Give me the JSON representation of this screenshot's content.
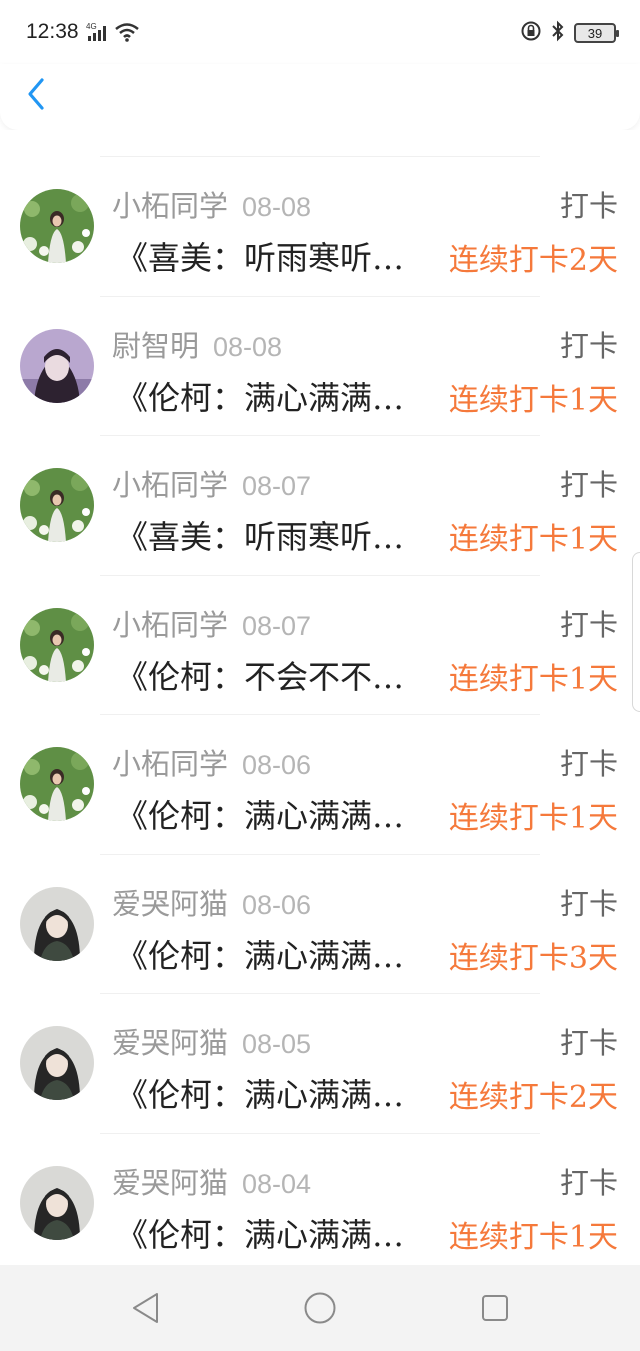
{
  "status_bar": {
    "time": "12:38",
    "network": "4G",
    "battery": "39"
  },
  "header": {
    "back_icon": "chevron-left-icon",
    "accent_color": "#2196f3"
  },
  "items": [
    {
      "name": "小柘同学",
      "date": "08-08",
      "label": "打卡",
      "title": "《喜美：听雨寒听雨寒",
      "streak": "连续打卡2天",
      "avatar": "flower-field"
    },
    {
      "name": "尉智明",
      "date": "08-08",
      "label": "打卡",
      "title": "《伦柯：满心满满心满",
      "streak": "连续打卡1天",
      "avatar": "purple-portrait"
    },
    {
      "name": "小柘同学",
      "date": "08-07",
      "label": "打卡",
      "title": "《喜美：听雨寒听雨寒",
      "streak": "连续打卡1天",
      "avatar": "flower-field"
    },
    {
      "name": "小柘同学",
      "date": "08-07",
      "label": "打卡",
      "title": "《伦柯：不会不不会不",
      "streak": "连续打卡1天",
      "avatar": "flower-field"
    },
    {
      "name": "小柘同学",
      "date": "08-06",
      "label": "打卡",
      "title": "《伦柯：满心满满心满",
      "streak": "连续打卡1天",
      "avatar": "flower-field"
    },
    {
      "name": "爱哭阿猫",
      "date": "08-06",
      "label": "打卡",
      "title": "《伦柯：满心满满心满",
      "streak": "连续打卡3天",
      "avatar": "grey-portrait"
    },
    {
      "name": "爱哭阿猫",
      "date": "08-05",
      "label": "打卡",
      "title": "《伦柯：满心满满心满",
      "streak": "连续打卡2天",
      "avatar": "grey-portrait"
    },
    {
      "name": "爱哭阿猫",
      "date": "08-04",
      "label": "打卡",
      "title": "《伦柯：满心满满心满",
      "streak": "连续打卡1天",
      "avatar": "grey-portrait"
    }
  ],
  "colors": {
    "streak": "#f5793b",
    "name": "#9a9a9a",
    "title": "#222222"
  }
}
